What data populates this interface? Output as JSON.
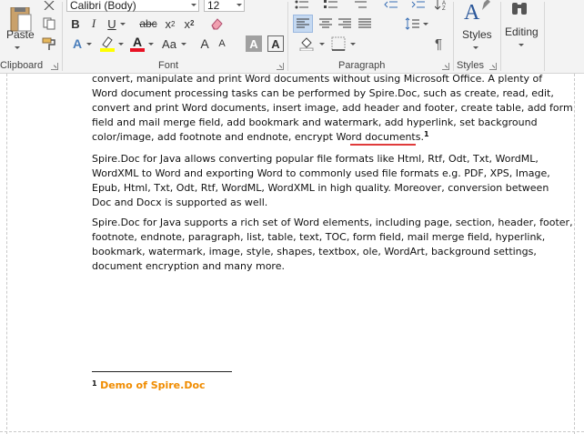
{
  "ribbon": {
    "clipboard": {
      "label": "Clipboard",
      "paste_label": "Paste"
    },
    "font": {
      "label": "Font",
      "font_name": "Calibri (Body)",
      "font_size": "12",
      "highlight_color": "#ffff00",
      "font_color": "#e81123"
    },
    "paragraph": {
      "label": "Paragraph"
    },
    "styles": {
      "label": "Styles",
      "button_label": "Styles"
    },
    "editing": {
      "button_label": "Editing"
    }
  },
  "document": {
    "paragraphs": [
      {
        "lines": [
          "convert, manipulate and print Word documents without using Microsoft Office. A plenty of",
          "Word document processing tasks can be performed by Spire.Doc, such as create, read, edit,",
          "convert and print Word documents, insert image, add header and footer, create table, add form",
          "field and mail merge field, add bookmark and watermark, add hyperlink, set background",
          "color/image, add footnote and endnote, encrypt Word documents."
        ],
        "footnote_ref": "1"
      },
      {
        "lines": [
          "Spire.Doc for Java allows converting popular file formats like Html, Rtf, Odt, Txt,  WordML,",
          "WordXML to Word and exporting Word to commonly used file formats e.g. PDF, XPS, Image,",
          "Epub, Html, Txt, Odt, Rtf, WordML, WordXML in high quality. Moreover, conversion between",
          "Doc and Docx is supported as well."
        ]
      },
      {
        "lines": [
          "Spire.Doc for Java supports a rich set of Word elements, including page, section, header, footer,",
          "footnote, endnote, paragraph, list, table, text, TOC, form field, mail merge field, hyperlink,",
          "bookmark, watermark, image, style, shapes, textbox, ole, WordArt, background settings,",
          "document encryption and many more."
        ]
      }
    ],
    "footnote": {
      "number": "1",
      "text": "Demo of Spire.Doc",
      "color": "#f08c00"
    }
  }
}
